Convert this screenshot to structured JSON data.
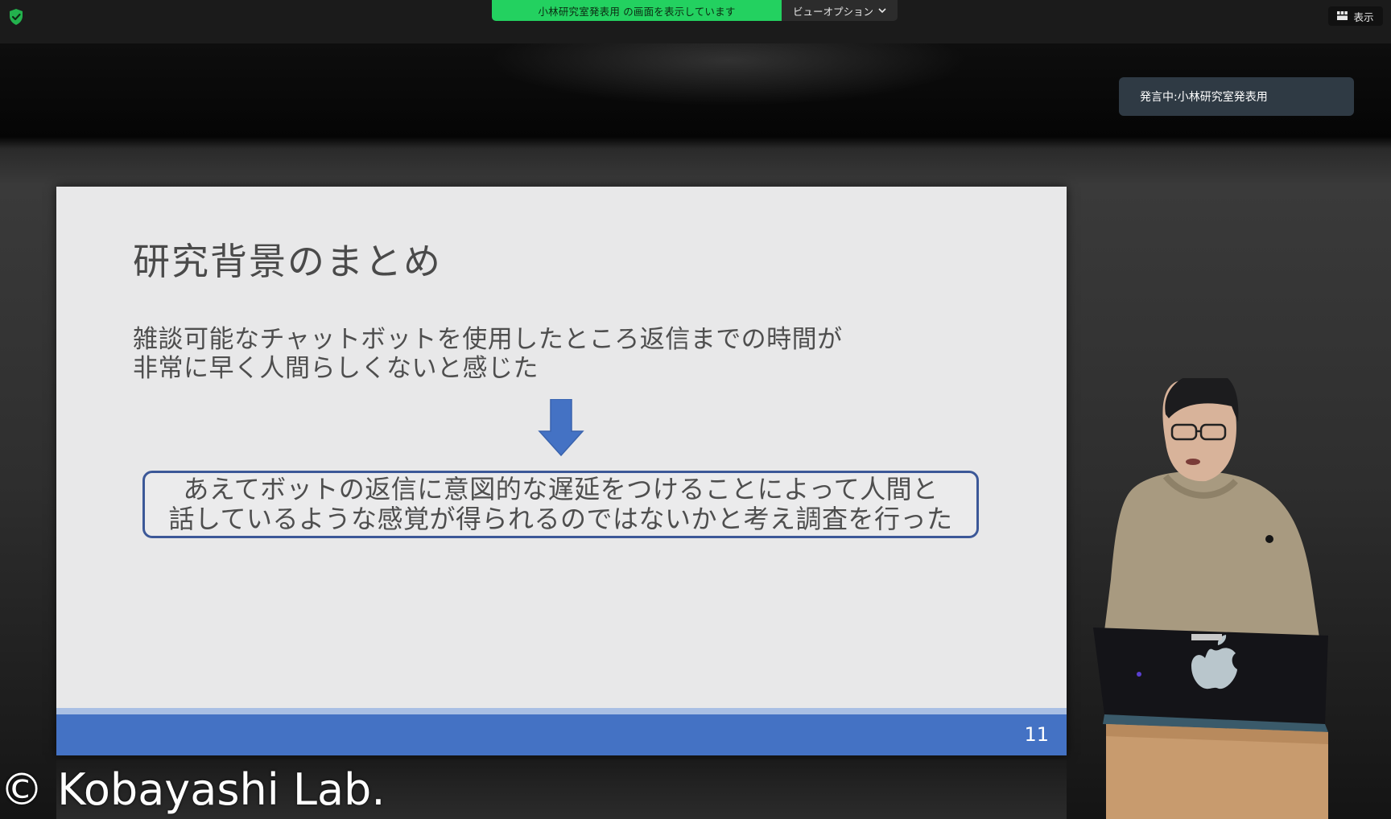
{
  "top_bar": {
    "share_banner": "小林研究室発表用 の画面を表示しています",
    "view_options_label": "ビューオプション",
    "display_label": "表示"
  },
  "speaker_tag": "発言中:小林研究室発表用",
  "slide": {
    "title": "研究背景のまとめ",
    "body_lines": [
      "雑談可能なチャットボットを使用したところ返信までの時間が",
      "非常に早く人間らしくないと感じた"
    ],
    "conclusion_lines": [
      "あえてボットの返信に意図的な遅延をつけることによって人間と",
      "話しているような感覚が得られるのではないかと考え調査を行った"
    ],
    "page_number": "11",
    "colors": {
      "background": "#e8e8e9",
      "footer": "#4472c4",
      "arrow": "#4472c4",
      "box_border": "#3c5898"
    }
  },
  "watermark": "© Kobayashi Lab.",
  "colors": {
    "share_banner": "#23d160",
    "speaker_tag": "#2f3a44"
  }
}
